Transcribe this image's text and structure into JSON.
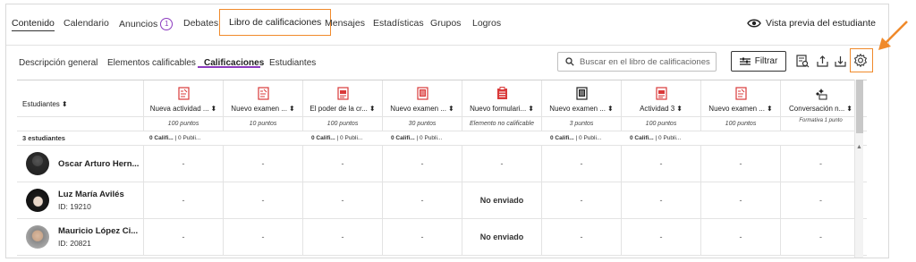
{
  "topnav": {
    "items": [
      {
        "label": "Contenido"
      },
      {
        "label": "Calendario"
      },
      {
        "label": "Anuncios",
        "badge": "1"
      },
      {
        "label": "Debates"
      },
      {
        "label": "Libro de calificaciones"
      },
      {
        "label": "Mensajes"
      },
      {
        "label": "Estadísticas"
      },
      {
        "label": "Grupos"
      },
      {
        "label": "Logros"
      }
    ],
    "preview_label": "Vista previa del estudiante"
  },
  "subnav": {
    "tabs": [
      {
        "label": "Descripción general"
      },
      {
        "label": "Elementos calificables"
      },
      {
        "label": "Calificaciones"
      },
      {
        "label": "Estudiantes"
      }
    ]
  },
  "toolbar": {
    "search_placeholder": "Buscar en el libro de calificaciones",
    "filter_label": "Filtrar"
  },
  "grid": {
    "students_header": "Estudiantes",
    "count_label": "3 estudiantes",
    "columns": [
      {
        "label": "Nueva actividad ...",
        "points": "100 puntos",
        "icon": "assignment-icon",
        "stats": [
          "0 Califi...",
          "| 0 Publi..."
        ]
      },
      {
        "label": "Nuevo examen ...",
        "points": "10 puntos",
        "icon": "assignment-icon",
        "stats": []
      },
      {
        "label": "El poder de la cr...",
        "points": "100 puntos",
        "icon": "document-icon",
        "stats": [
          "0 Califi...",
          "| 0 Publi..."
        ]
      },
      {
        "label": "Nuevo examen ...",
        "points": "30 puntos",
        "icon": "test-icon",
        "stats": [
          "0 Califi...",
          "| 0 Publi..."
        ]
      },
      {
        "label": "Nuevo formulari...",
        "points": "Elemento no calificable",
        "icon": "form-icon",
        "stats": []
      },
      {
        "label": "Nuevo examen ...",
        "points": "3 puntos",
        "icon": "test-dark-icon",
        "stats": [
          "0 Califi...",
          "| 0 Publi..."
        ]
      },
      {
        "label": "Actividad 3",
        "points": "100 puntos",
        "icon": "document-icon",
        "stats": [
          "0 Califi...",
          "| 0 Publi..."
        ]
      },
      {
        "label": "Nuevo examen ...",
        "points": "100 puntos",
        "icon": "assignment-icon",
        "stats": []
      },
      {
        "label": "Conversación n...",
        "points": "Formativa 1 punto",
        "icon": "sparkle-chat-icon",
        "stats": []
      }
    ],
    "students": [
      {
        "name": "Oscar Arturo Hern...",
        "id": "",
        "cells": [
          "-",
          "-",
          "-",
          "-",
          "-",
          "-",
          "-",
          "-",
          "-"
        ]
      },
      {
        "name": "Luz María Avilés",
        "id": "ID: 19210",
        "cells": [
          "-",
          "-",
          "-",
          "-",
          "No enviado",
          "-",
          "-",
          "-",
          "-"
        ]
      },
      {
        "name": "Mauricio López Ci...",
        "id": "ID: 20821",
        "cells": [
          "-",
          "-",
          "-",
          "-",
          "No enviado",
          "-",
          "-",
          "-",
          "-"
        ]
      }
    ]
  },
  "colors": {
    "accent": "#8c3bbf",
    "highlight": "#f08a2b",
    "icon_red": "#d93a3a"
  }
}
